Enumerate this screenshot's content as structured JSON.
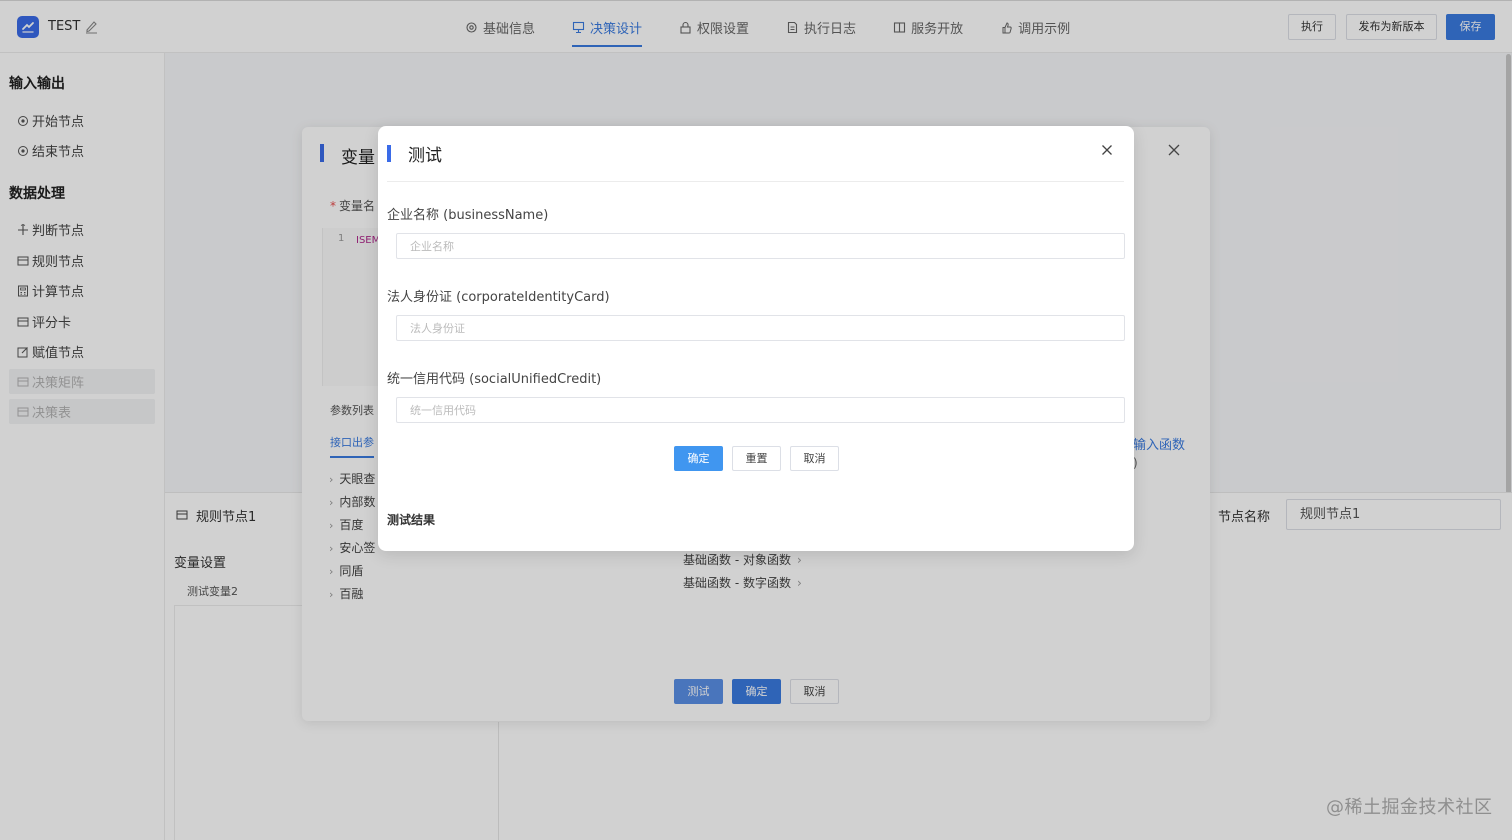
{
  "header": {
    "app_title": "TEST",
    "nav": [
      {
        "label": "基础信息",
        "icon": "gear-icon",
        "active": false
      },
      {
        "label": "决策设计",
        "icon": "flow-icon",
        "active": true
      },
      {
        "label": "权限设置",
        "icon": "lock-icon",
        "active": false
      },
      {
        "label": "执行日志",
        "icon": "log-icon",
        "active": false
      },
      {
        "label": "服务开放",
        "icon": "book-icon",
        "active": false
      },
      {
        "label": "调用示例",
        "icon": "hand-icon",
        "active": false
      }
    ],
    "btn_execute": "执行",
    "btn_publish": "发布为新版本",
    "btn_save": "保存"
  },
  "sidebar": {
    "group_io": "输入输出",
    "group_data": "数据处理",
    "items": [
      {
        "label": "开始节点",
        "icon": "circle-dot-icon"
      },
      {
        "label": "结束节点",
        "icon": "circle-dot-icon"
      },
      {
        "label": "判断节点",
        "icon": "cross-icon"
      },
      {
        "label": "规则节点",
        "icon": "rule-icon"
      },
      {
        "label": "计算节点",
        "icon": "calculator-icon"
      },
      {
        "label": "评分卡",
        "icon": "card-icon"
      },
      {
        "label": "赋值节点",
        "icon": "edit-icon"
      },
      {
        "label": "决策矩阵",
        "icon": "matrix-icon"
      },
      {
        "label": "决策表",
        "icon": "table-icon"
      }
    ]
  },
  "bottom_panel": {
    "node_title": "规则节点1",
    "section_vars": "变量设置",
    "var_item": "测试变量2",
    "node_name_label": "节点名称",
    "node_name_value": "规则节点1"
  },
  "var_dialog": {
    "title": "变量",
    "var_name_label": "变量名",
    "code_line": "1",
    "code_text": "ISEM",
    "param_label": "参数列表",
    "param_tab": "接口出参",
    "tree": [
      "天眼查",
      "内部数",
      "百度",
      "安心签",
      "同盾",
      "百融"
    ],
    "fn_link": "输入函数",
    "fn_paren": ")",
    "fn_items": [
      "基础函数 - 对象函数",
      "基础函数 - 数字函数"
    ],
    "btn_test": "测试",
    "btn_ok": "确定",
    "btn_cancel": "取消"
  },
  "test_dialog": {
    "title": "测试",
    "fields": [
      {
        "label": "企业名称 (businessName)",
        "placeholder": "企业名称",
        "value": ""
      },
      {
        "label": "法人身份证 (corporateIdentityCard)",
        "placeholder": "法人身份证",
        "value": ""
      },
      {
        "label": "统一信用代码 (socialUnifiedCredit)",
        "placeholder": "统一信用代码",
        "value": ""
      }
    ],
    "btn_ok": "确定",
    "btn_reset": "重置",
    "btn_cancel": "取消",
    "result_label": "测试结果"
  },
  "watermark": "@稀土掘金技术社区",
  "colors": {
    "primary": "#3a7be0",
    "brand": "#3a6be8",
    "button_blue": "#4096f0"
  }
}
